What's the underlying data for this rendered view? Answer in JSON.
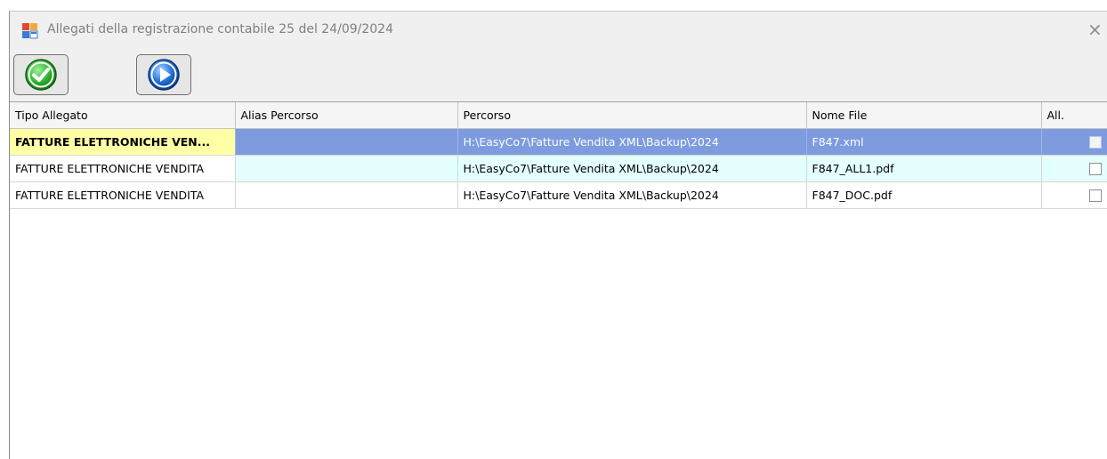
{
  "window": {
    "title": "Allegati della registrazione contabile 25 del 24/09/2024",
    "close_glyph": "×"
  },
  "toolbar": {
    "confirm_icon": "check-icon",
    "next_icon": "play-icon"
  },
  "grid": {
    "columns": [
      "Tipo Allegato",
      "Alias Percorso",
      "Percorso",
      "Nome File",
      "All."
    ],
    "rows": [
      {
        "tipo": "FATTURE ELETTRONICHE VEN...",
        "alias": "",
        "percorso": "H:\\EasyCo7\\Fatture Vendita XML\\Backup\\2024",
        "nome_file": "F847.xml",
        "all": false
      },
      {
        "tipo": "FATTURE ELETTRONICHE VENDITA",
        "alias": "",
        "percorso": "H:\\EasyCo7\\Fatture Vendita XML\\Backup\\2024",
        "nome_file": "F847_ALL1.pdf",
        "all": false
      },
      {
        "tipo": "FATTURE ELETTRONICHE VENDITA",
        "alias": "",
        "percorso": "H:\\EasyCo7\\Fatture Vendita XML\\Backup\\2024",
        "nome_file": "F847_DOC.pdf",
        "all": false
      }
    ]
  },
  "colors": {
    "selected_row": "#7d9bde",
    "selected_first_cell": "#ffffa6",
    "alt_row": "#e3ffff",
    "confirm_green": "#2fb52f",
    "next_blue": "#1f6fd6"
  }
}
